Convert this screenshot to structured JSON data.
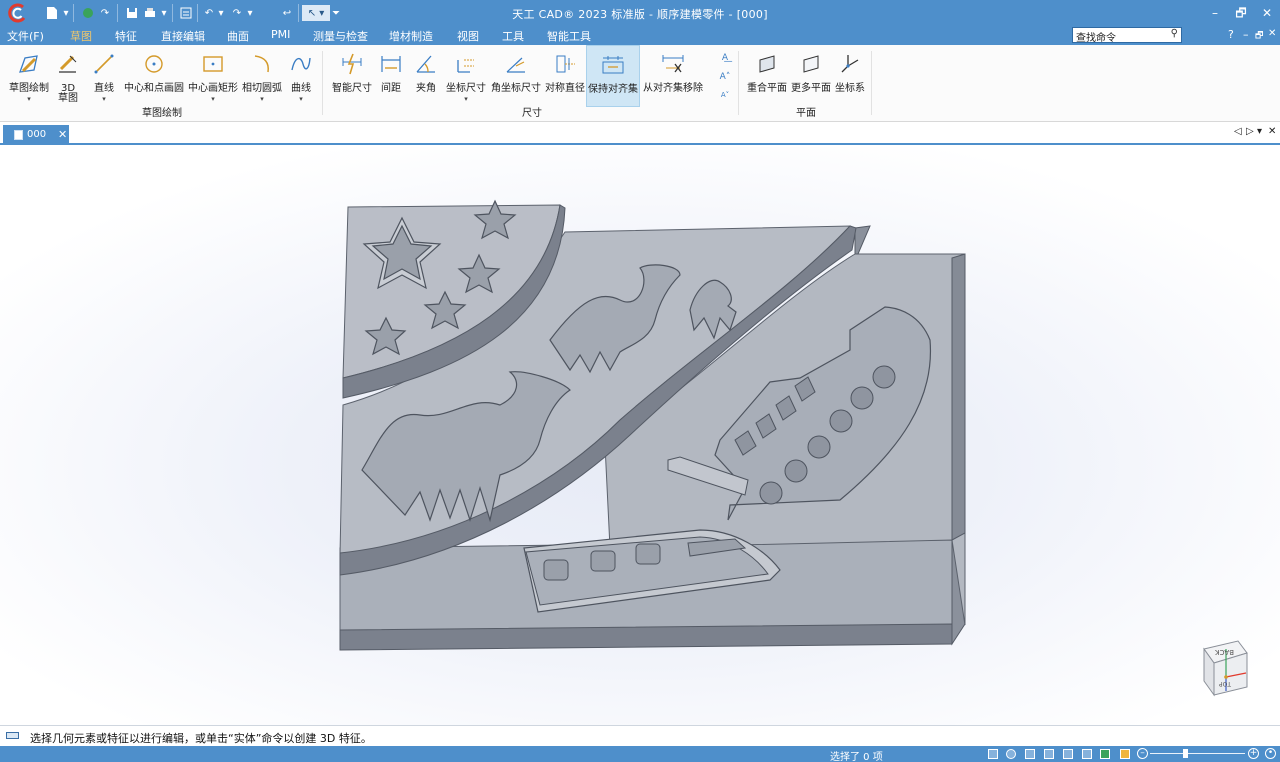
{
  "window": {
    "title": "天工 CAD® 2023 标准版 - 顺序建模零件 - [000]",
    "minimize": "–",
    "restore": "🗗",
    "close": "✕"
  },
  "menu": {
    "items": [
      {
        "label": "文件(F)"
      },
      {
        "label": "草图",
        "active": true
      },
      {
        "label": "特征"
      },
      {
        "label": "直接编辑"
      },
      {
        "label": "曲面"
      },
      {
        "label": "PMI"
      },
      {
        "label": "测量与检查"
      },
      {
        "label": "增材制造"
      },
      {
        "label": "视图"
      },
      {
        "label": "工具"
      },
      {
        "label": "智能工具"
      }
    ],
    "search_text": "查找命令",
    "help": "?",
    "min": "–",
    "restore": "🗗",
    "close": "✕"
  },
  "ribbon": {
    "tools": [
      {
        "label": "草图绘制",
        "icon": "sketch-pencil-icon"
      },
      {
        "label": "3D",
        "label2": "草图",
        "icon": "3d-sketch-icon"
      },
      {
        "label": "直线",
        "icon": "line-icon"
      },
      {
        "label": "中心和点画圆",
        "icon": "circle-center-icon"
      },
      {
        "label": "中心画矩形",
        "icon": "rectangle-center-icon"
      },
      {
        "label": "相切圆弧",
        "icon": "tangent-arc-icon"
      },
      {
        "label": "曲线",
        "icon": "curve-icon"
      },
      {
        "label": "智能尺寸",
        "icon": "smart-dimension-icon"
      },
      {
        "label": "间距",
        "icon": "distance-icon"
      },
      {
        "label": "夹角",
        "icon": "angle-icon"
      },
      {
        "label": "坐标尺寸",
        "icon": "coordinate-dimension-icon"
      },
      {
        "label": "角坐标尺寸",
        "icon": "angular-coordinate-icon"
      },
      {
        "label": "对称直径",
        "icon": "symmetric-diameter-icon"
      },
      {
        "label": "保持对齐集",
        "icon": "keep-align-set-icon"
      },
      {
        "label": "从对齐集移除",
        "icon": "remove-align-icon"
      },
      {
        "label": "重合平面",
        "icon": "coincident-plane-icon"
      },
      {
        "label": "更多平面",
        "icon": "more-planes-icon"
      },
      {
        "label": "坐标系",
        "icon": "coordinate-system-icon"
      }
    ],
    "groups": {
      "sketch": "草图绘制",
      "dimension": "尺寸",
      "plane": "平面"
    }
  },
  "document": {
    "tab_name": "000"
  },
  "viewcube": {
    "face_top": "BACK",
    "face_front": "TOP"
  },
  "status": {
    "prompt": "选择几何元素或特征以进行编辑，或单击“实体”命令以创建 3D 特征。",
    "selection": "选择了 0 项"
  },
  "colors": {
    "accent": "#4e8fcb",
    "highlight": "#cfe6f5",
    "model_surface": "#b4b9c2"
  }
}
